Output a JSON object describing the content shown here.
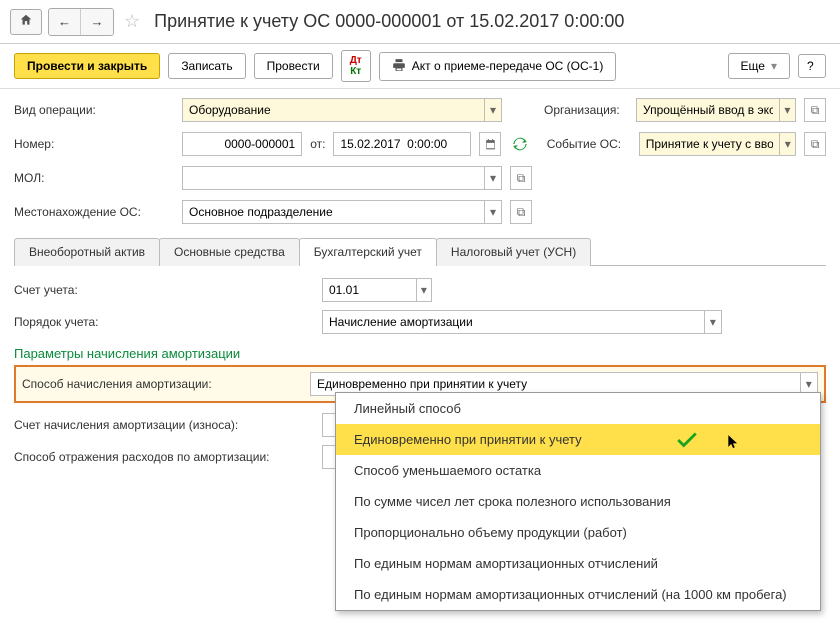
{
  "header": {
    "title": "Принятие к учету ОС 0000-000001 от 15.02.2017 0:00:00"
  },
  "toolbar": {
    "post_close": "Провести и закрыть",
    "save": "Записать",
    "post": "Провести",
    "act": "Акт о приеме-передаче ОС (ОС-1)",
    "more": "Еще"
  },
  "form": {
    "op_type_label": "Вид операции:",
    "op_type_value": "Оборудование",
    "org_label": "Организация:",
    "org_value": "Упрощённый ввод в экспл. О",
    "number_label": "Номер:",
    "number_value": "0000-000001",
    "from_label": "от:",
    "date_value": "15.02.2017  0:00:00",
    "event_label": "Событие ОС:",
    "event_value": "Принятие к учету с вводом в",
    "mol_label": "МОЛ:",
    "mol_value": "",
    "location_label": "Местонахождение ОС:",
    "location_value": "Основное подразделение"
  },
  "tabs": [
    "Внеоборотный актив",
    "Основные средства",
    "Бухгалтерский учет",
    "Налоговый учет (УСН)"
  ],
  "accounting": {
    "account_label": "Счет учета:",
    "account_value": "01.01",
    "order_label": "Порядок учета:",
    "order_value": "Начисление амортизации",
    "section_title": "Параметры начисления амортизации",
    "method_label": "Способ начисления амортизации:",
    "method_value": "Единовременно при принятии к учету",
    "depr_account_label": "Счет начисления амортизации (износа):",
    "depr_account_value": "",
    "expense_label": "Способ отражения расходов по амортизации:",
    "expense_value": ""
  },
  "dropdown_options": [
    "Линейный способ",
    "Единовременно при принятии к учету",
    "Способ уменьшаемого остатка",
    "По сумме чисел лет срока полезного использования",
    "Пропорционально объему продукции (работ)",
    "По единым нормам амортизационных отчислений",
    "По единым нормам амортизационных отчислений (на 1000 км пробега)"
  ]
}
